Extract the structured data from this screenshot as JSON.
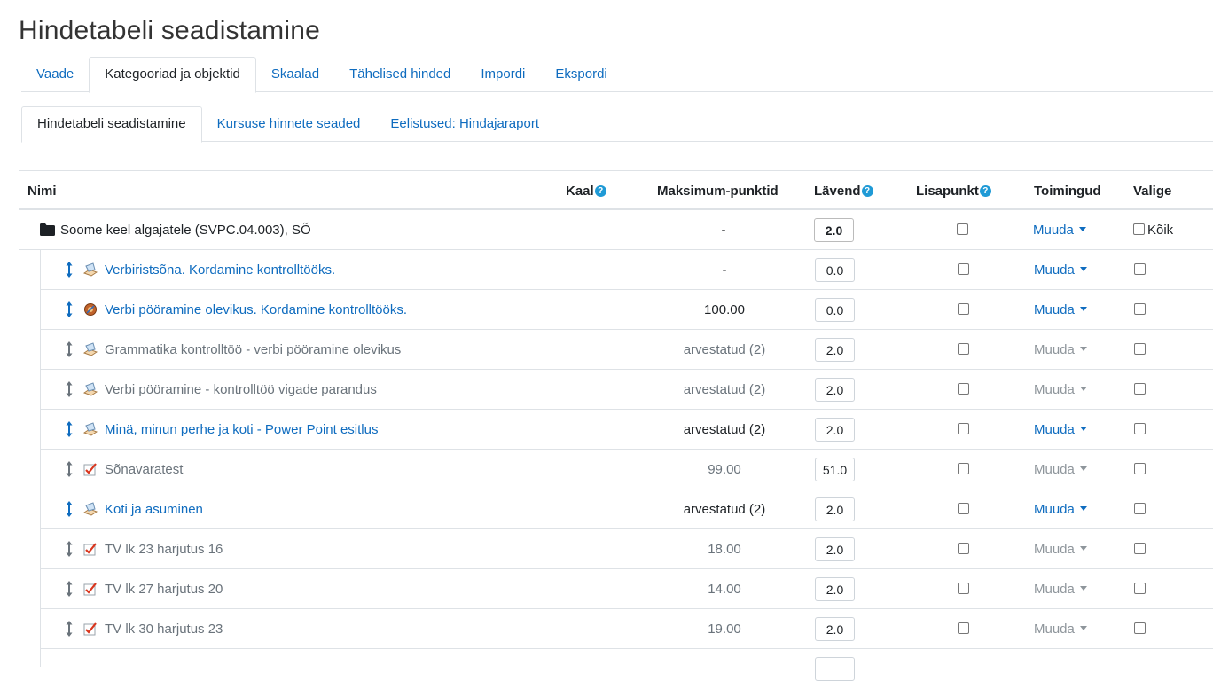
{
  "page_title": "Hindetabeli seadistamine",
  "primary_tabs": [
    {
      "label": "Vaade",
      "active": false
    },
    {
      "label": "Kategooriad ja objektid",
      "active": true
    },
    {
      "label": "Skaalad",
      "active": false
    },
    {
      "label": "Tähelised hinded",
      "active": false
    },
    {
      "label": "Impordi",
      "active": false
    },
    {
      "label": "Ekspordi",
      "active": false
    }
  ],
  "secondary_tabs": [
    {
      "label": "Hindetabeli seadistamine",
      "active": true
    },
    {
      "label": "Kursuse hinnete seaded",
      "active": false
    },
    {
      "label": "Eelistused: Hindajaraport",
      "active": false
    }
  ],
  "columns": {
    "name": "Nimi",
    "weight": "Kaal",
    "max_points": "Maksimum-punktid",
    "threshold": "Lävend",
    "extra_credit": "Lisapunkt",
    "actions": "Toimingud",
    "select": "Valige"
  },
  "help_icon_glyph": "?",
  "category": {
    "name": "Soome keel algajatele (SVPC.04.003), SÕ",
    "max_points": "-",
    "threshold": "2.0",
    "action_label": "Muuda",
    "select_all_label": "Kõik"
  },
  "items": [
    {
      "name": "Verbiristsõna. Kordamine kontrolltööks.",
      "icon": "assignment-icon",
      "max_points": "-",
      "threshold": "0.0",
      "action_label": "Muuda",
      "style": "link"
    },
    {
      "name": "Verbi pööramine olevikus. Kordamine kontrolltööks.",
      "icon": "hotpot-icon",
      "max_points": "100.00",
      "threshold": "0.0",
      "action_label": "Muuda",
      "style": "link"
    },
    {
      "name": "Grammatika kontrolltöö - verbi pööramine olevikus",
      "icon": "assignment-icon",
      "max_points": "arvestatud (2)",
      "threshold": "2.0",
      "action_label": "Muuda",
      "style": "dim"
    },
    {
      "name": "Verbi pööramine - kontrolltöö vigade parandus",
      "icon": "assignment-icon",
      "max_points": "arvestatud (2)",
      "threshold": "2.0",
      "action_label": "Muuda",
      "style": "dim"
    },
    {
      "name": "Minä, minun perhe ja koti - Power Point esitlus",
      "icon": "assignment-icon",
      "max_points": "arvestatud (2)",
      "threshold": "2.0",
      "action_label": "Muuda",
      "style": "link"
    },
    {
      "name": "Sõnavaratest",
      "icon": "quiz-icon",
      "max_points": "99.00",
      "threshold": "51.0",
      "action_label": "Muuda",
      "style": "dim"
    },
    {
      "name": "Koti ja asuminen",
      "icon": "assignment-icon",
      "max_points": "arvestatud (2)",
      "threshold": "2.0",
      "action_label": "Muuda",
      "style": "link"
    },
    {
      "name": "TV lk 23 harjutus 16",
      "icon": "quiz-icon",
      "max_points": "18.00",
      "threshold": "2.0",
      "action_label": "Muuda",
      "style": "dim"
    },
    {
      "name": "TV lk 27 harjutus 20",
      "icon": "quiz-icon",
      "max_points": "14.00",
      "threshold": "2.0",
      "action_label": "Muuda",
      "style": "dim"
    },
    {
      "name": "TV lk 30 harjutus 23",
      "icon": "quiz-icon",
      "max_points": "19.00",
      "threshold": "2.0",
      "action_label": "Muuda",
      "style": "dim"
    }
  ],
  "colors": {
    "link": "#0f6cbf",
    "dim_text": "#6a737b",
    "help_icon": "#1f9ad6",
    "border": "#dee2e6"
  }
}
